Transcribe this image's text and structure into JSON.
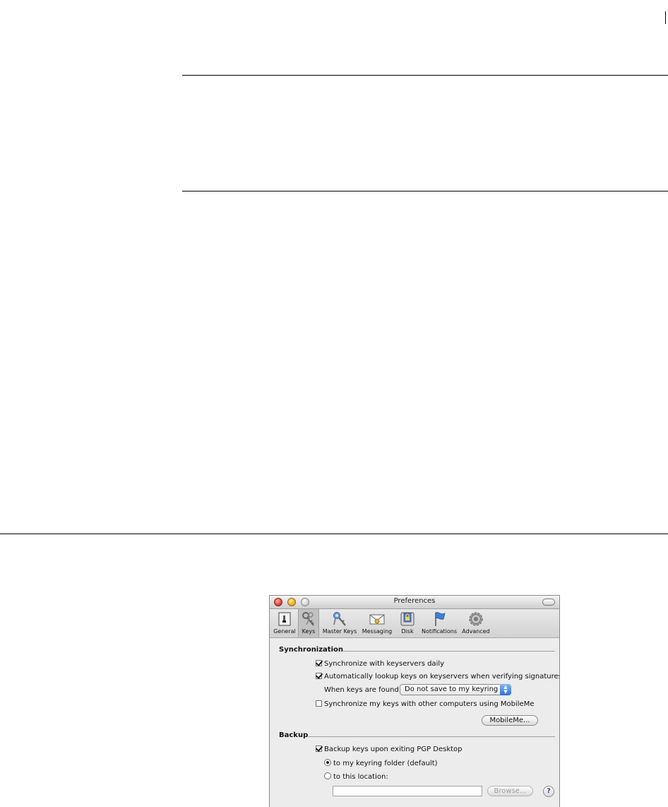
{
  "window": {
    "title": "Preferences"
  },
  "toolbar": {
    "items": [
      {
        "label": "General",
        "icon": "switch-icon"
      },
      {
        "label": "Keys",
        "icon": "keys-icon",
        "selected": true
      },
      {
        "label": "Master Keys",
        "icon": "master-keys-icon"
      },
      {
        "label": "Messaging",
        "icon": "envelope-icon"
      },
      {
        "label": "Disk",
        "icon": "disk-lock-icon"
      },
      {
        "label": "Notifications",
        "icon": "flag-icon"
      },
      {
        "label": "Advanced",
        "icon": "gear-icon"
      }
    ]
  },
  "synchronization": {
    "heading": "Synchronization",
    "sync_daily": {
      "label": "Synchronize with keyservers daily",
      "checked": true
    },
    "auto_lookup": {
      "label": "Automatically lookup keys on keyservers when verifying signatures",
      "checked": true
    },
    "when_found_label": "When keys are found:",
    "when_found_value": "Do not save to my keyring",
    "mobileme_sync": {
      "label": "Synchronize my keys with other computers using MobileMe",
      "checked": false
    },
    "mobileme_button": "MobileMe..."
  },
  "backup": {
    "heading": "Backup",
    "backup_on_exit": {
      "label": "Backup keys upon exiting PGP Desktop",
      "checked": true
    },
    "option_folder": {
      "label": "to my keyring folder (default)",
      "selected": true
    },
    "option_location": {
      "label": "to this location:",
      "selected": false
    },
    "location_value": "",
    "browse_button": "Browse...",
    "help_glyph": "?"
  }
}
